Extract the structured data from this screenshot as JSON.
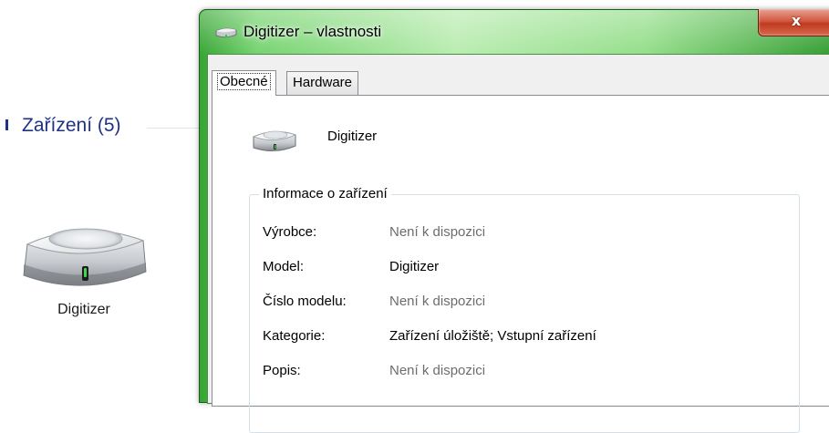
{
  "background_pane": {
    "group_header": "Zařízení (5)",
    "device_tile": {
      "label": "Digitizer",
      "icon": "hard-drive-icon"
    }
  },
  "window": {
    "title": "Digitizer – vlastnosti",
    "title_icon": "drive-icon",
    "close_label": "x",
    "accent_color": "#5fc95a",
    "tabs": [
      {
        "label": "Obecné",
        "active": true
      },
      {
        "label": "Hardware",
        "active": false
      }
    ],
    "general": {
      "device_name": "Digitizer",
      "device_icon": "drive-icon",
      "info_group_title": "Informace o zařízení",
      "properties": [
        {
          "label": "Výrobce:",
          "value": "Není k dispozici",
          "available": false
        },
        {
          "label": "Model:",
          "value": "Digitizer",
          "available": true
        },
        {
          "label": "Číslo modelu:",
          "value": "Není k dispozici",
          "available": false
        },
        {
          "label": "Kategorie:",
          "value": "Zařízení úložiště; Vstupní zařízení",
          "available": true
        },
        {
          "label": "Popis:",
          "value": "Není k dispozici",
          "available": false
        }
      ]
    }
  }
}
